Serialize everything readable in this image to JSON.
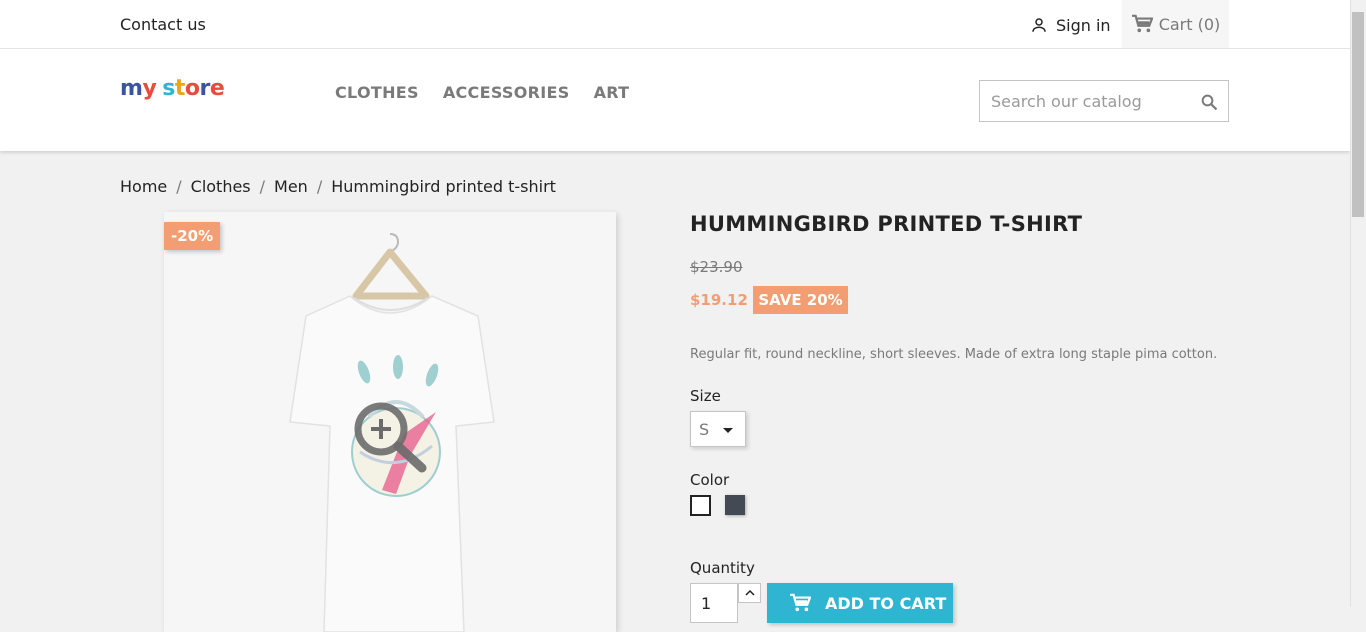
{
  "topbar": {
    "contact_label": "Contact us",
    "signin_label": "Sign in",
    "cart_label": "Cart (0)"
  },
  "header": {
    "logo_text": "my store",
    "nav": [
      "CLOTHES",
      "ACCESSORIES",
      "ART"
    ],
    "search_placeholder": "Search our catalog"
  },
  "breadcrumb": [
    "Home",
    "Clothes",
    "Men",
    "Hummingbird printed t-shirt"
  ],
  "product": {
    "discount_flag": "-20%",
    "title": "HUMMINGBIRD PRINTED T-SHIRT",
    "old_price": "$23.90",
    "new_price": "$19.12",
    "save_badge": "SAVE 20%",
    "description": "Regular fit, round neckline, short sleeves. Made of extra long staple pima cotton.",
    "size_label": "Size",
    "size_value": "S",
    "color_label": "Color",
    "colors": [
      "#ffffff",
      "#434a54"
    ],
    "quantity_label": "Quantity",
    "quantity_value": "1",
    "add_to_cart_label": "ADD TO CART"
  },
  "colors": {
    "accent": "#2fb5d2",
    "discount": "#f39d72",
    "text": "#232323",
    "muted": "#7a7a7a"
  }
}
